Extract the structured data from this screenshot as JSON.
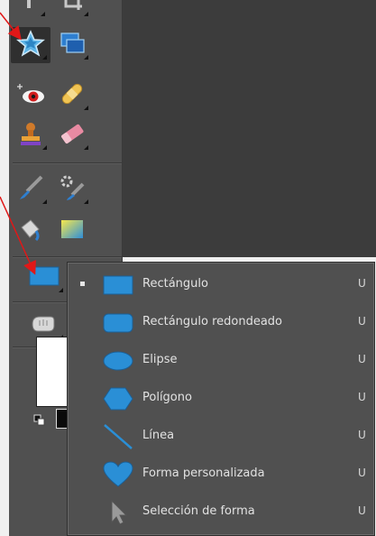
{
  "toolbar": {
    "tools": [
      {
        "icon": "text-tool-icon"
      },
      {
        "icon": "crop-tool-icon"
      },
      {
        "icon": "star-shape-icon"
      },
      {
        "icon": "transform-tool-icon"
      },
      {
        "icon": "red-eye-tool-icon"
      },
      {
        "icon": "healing-bandage-icon"
      },
      {
        "icon": "clone-stamp-icon"
      },
      {
        "icon": "eraser-icon"
      },
      {
        "icon": "brush-tool-icon"
      },
      {
        "icon": "smart-brush-icon"
      },
      {
        "icon": "paint-bucket-icon"
      },
      {
        "icon": "gradient-tool-icon"
      },
      {
        "icon": "rectangle-shape-icon"
      },
      {
        "icon": "hand-tool-icon"
      }
    ],
    "foreground_color": "#ffffff",
    "background_color": "#000000"
  },
  "shape_menu": {
    "items": [
      {
        "label": "Rectángulo",
        "shortcut": "U",
        "icon": "rectangle-icon",
        "selected": true
      },
      {
        "label": "Rectángulo redondeado",
        "shortcut": "U",
        "icon": "rounded-rectangle-icon",
        "selected": false
      },
      {
        "label": "Elipse",
        "shortcut": "U",
        "icon": "ellipse-icon",
        "selected": false
      },
      {
        "label": "Polígono",
        "shortcut": "U",
        "icon": "polygon-icon",
        "selected": false
      },
      {
        "label": "Línea",
        "shortcut": "U",
        "icon": "line-icon",
        "selected": false
      },
      {
        "label": "Forma personalizada",
        "shortcut": "U",
        "icon": "custom-shape-heart-icon",
        "selected": false
      },
      {
        "label": "Selección de forma",
        "shortcut": "U",
        "icon": "shape-selection-arrow-icon",
        "selected": false
      }
    ]
  },
  "colors": {
    "accent_blue": "#2a8fd6",
    "annotation_red": "#e01818"
  }
}
